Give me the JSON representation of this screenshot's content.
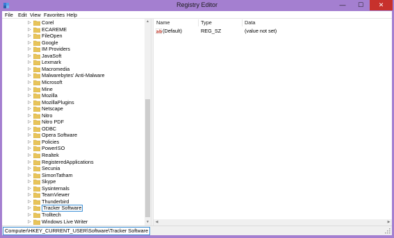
{
  "window": {
    "title": "Registry Editor",
    "controls": {
      "minimize": "—",
      "maximize": "☐",
      "close": "✕"
    }
  },
  "menu": [
    "File",
    "Edit",
    "View",
    "Favorites",
    "Help"
  ],
  "tree": {
    "items": [
      {
        "label": "Corel",
        "icon": "folder-icon"
      },
      {
        "label": "ECAREME",
        "icon": "folder-icon"
      },
      {
        "label": "FileOpen",
        "icon": "folder-icon"
      },
      {
        "label": "Google",
        "icon": "folder-icon"
      },
      {
        "label": "IM Providers",
        "icon": "folder-icon"
      },
      {
        "label": "JavaSoft",
        "icon": "folder-icon"
      },
      {
        "label": "Lexmark",
        "icon": "folder-icon"
      },
      {
        "label": "Macromedia",
        "icon": "folder-icon"
      },
      {
        "label": "Malwarebytes' Anti-Malware",
        "icon": "folder-icon"
      },
      {
        "label": "Microsoft",
        "icon": "folder-icon"
      },
      {
        "label": "Mine",
        "icon": "folder-icon"
      },
      {
        "label": "Mozilla",
        "icon": "folder-icon"
      },
      {
        "label": "MozillaPlugins",
        "icon": "folder-icon"
      },
      {
        "label": "Netscape",
        "icon": "folder-icon"
      },
      {
        "label": "Nitro",
        "icon": "folder-icon"
      },
      {
        "label": "Nitro PDF",
        "icon": "folder-icon"
      },
      {
        "label": "ODBC",
        "icon": "folder-icon"
      },
      {
        "label": "Opera Software",
        "icon": "folder-icon"
      },
      {
        "label": "Policies",
        "icon": "folder-icon"
      },
      {
        "label": "PowerISO",
        "icon": "folder-icon"
      },
      {
        "label": "Realtek",
        "icon": "folder-icon"
      },
      {
        "label": "RegisteredApplications",
        "icon": "folder-icon"
      },
      {
        "label": "Secunia",
        "icon": "folder-icon"
      },
      {
        "label": "SimonTatham",
        "icon": "folder-icon"
      },
      {
        "label": "Skype",
        "icon": "folder-icon"
      },
      {
        "label": "Sysinternals",
        "icon": "folder-icon"
      },
      {
        "label": "TeamViewer",
        "icon": "folder-icon"
      },
      {
        "label": "Thunderbird",
        "icon": "folder-icon"
      },
      {
        "label": "Tracker Software",
        "icon": "folder-icon",
        "selected": true
      },
      {
        "label": "Trolltech",
        "icon": "folder-icon"
      },
      {
        "label": "Windows Live Writer",
        "icon": "folder-icon"
      }
    ],
    "expander_glyph": "▷"
  },
  "list": {
    "columns": [
      "Name",
      "Type",
      "Data"
    ],
    "rows": [
      {
        "name": "(Default)",
        "type": "REG_SZ",
        "data": "(value not set)",
        "icon": "string-value-icon"
      }
    ]
  },
  "statusbar": {
    "path": "Computer\\HKEY_CURRENT_USER\\Software\\Tracker Software"
  },
  "colors": {
    "titlebar": "#a47fd0",
    "close_button": "#c7312c",
    "selection_border": "#3b8fd6",
    "folder": "#e8c45a"
  }
}
